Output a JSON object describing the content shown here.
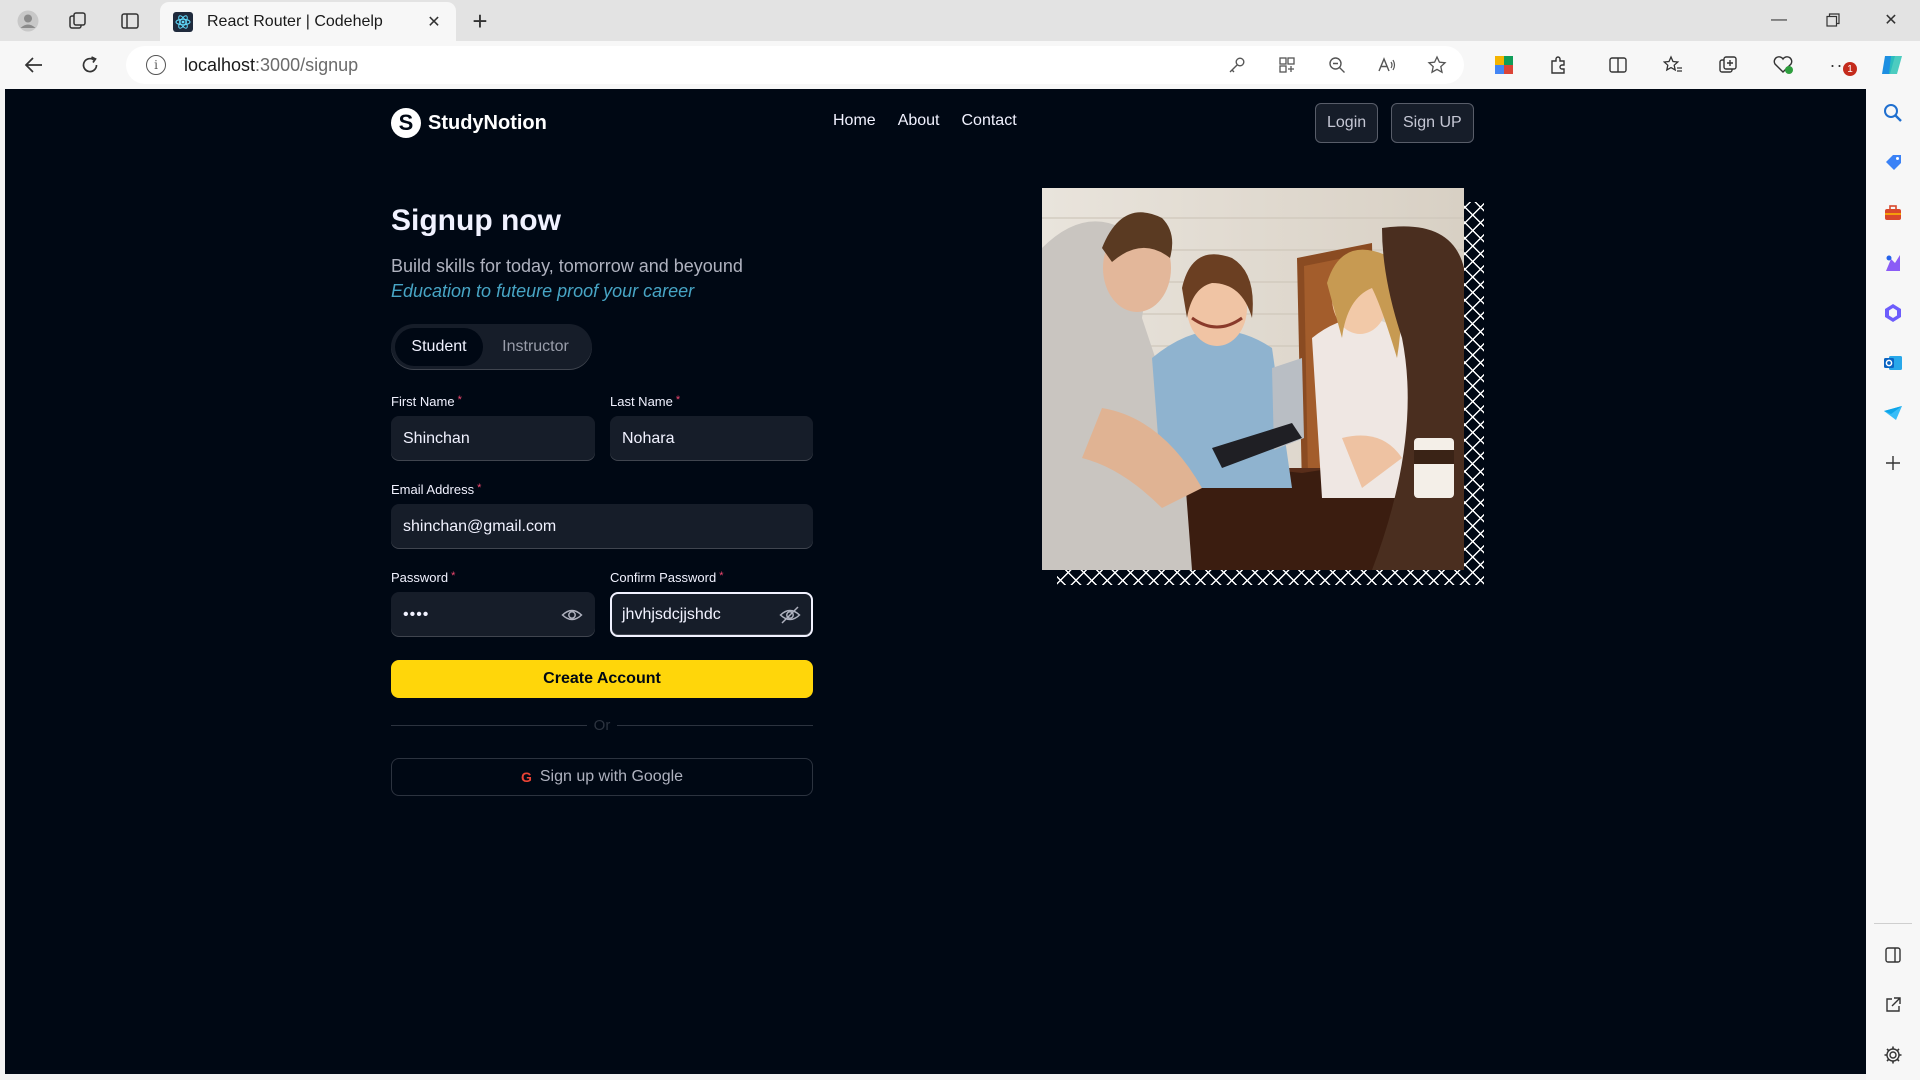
{
  "browser": {
    "tab_title": "React Router | Codehelp",
    "url_host": "localhost",
    "url_path": ":3000/signup",
    "notification_badge": "1"
  },
  "site": {
    "brand": "StudyNotion",
    "logo_letter": "S",
    "nav": [
      "Home",
      "About",
      "Contact"
    ],
    "login_label": "Login",
    "signup_label": "Sign UP"
  },
  "signup": {
    "heading": "Signup now",
    "subtitle": "Build skills for today, tomorrow and beyound",
    "tagline": "Education to futeure proof your career",
    "role_options": [
      "Student",
      "Instructor"
    ],
    "selected_role": "Student",
    "required_mark": "*",
    "first_name_label": "First Name",
    "first_name_value": "Shinchan",
    "last_name_label": "Last Name",
    "last_name_value": "Nohara",
    "email_label": "Email Address",
    "email_value": "shinchan@gmail.com",
    "password_label": "Password",
    "password_value": "••••",
    "confirm_password_label": "Confirm Password",
    "confirm_password_value": "jhvhjsdcjjshdc",
    "create_button": "Create Account",
    "divider_text": "Or",
    "google_button": "Sign up with Google",
    "google_letter": "G"
  },
  "colors": {
    "background": "#000814",
    "input_bg": "#161D29",
    "accent_yellow": "#FFD60A",
    "tagline_blue": "#47A5C5",
    "required_red": "#EF476F"
  }
}
